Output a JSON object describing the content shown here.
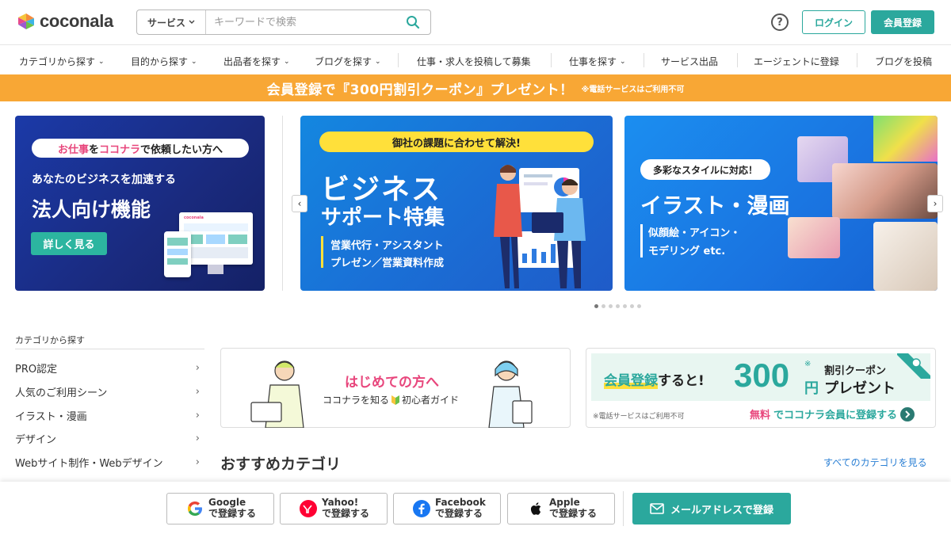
{
  "header": {
    "logo_text": "coconala",
    "search_category": "サービス",
    "search_placeholder": "キーワードで検索",
    "help_label": "?",
    "login_label": "ログイン",
    "register_label": "会員登録"
  },
  "nav": {
    "items": [
      {
        "label": "カテゴリから探す",
        "dropdown": true
      },
      {
        "label": "目的から探す",
        "dropdown": true
      },
      {
        "label": "出品者を探す",
        "dropdown": true
      },
      {
        "label": "ブログを探す",
        "dropdown": true
      },
      {
        "label": "仕事・求人を投稿して募集",
        "dropdown": false
      },
      {
        "label": "仕事を探す",
        "dropdown": true
      },
      {
        "label": "サービス出品",
        "dropdown": false
      },
      {
        "label": "エージェントに登録",
        "dropdown": false
      },
      {
        "label": "ブログを投稿",
        "dropdown": false
      }
    ]
  },
  "promo": {
    "main": "会員登録で『300円割引クーポン』プレゼント！",
    "note": "※電話サービスはご利用不可"
  },
  "banners": {
    "b1": {
      "tag_part1": "お仕事",
      "tag_part2": "を",
      "tag_part3": "ココナラ",
      "tag_part4": "で依頼したい方へ",
      "line1": "あなたのビジネスを加速する",
      "title": "法人向け機能",
      "button": "詳しく見る",
      "mini_logo": "coconala"
    },
    "b2": {
      "tag": "御社の課題に合わせて解決!",
      "title1": "ビジネス",
      "title2": "サポート特集",
      "sub1": "営業代行・アシスタント",
      "sub2": "プレゼン／営業資料作成"
    },
    "b3": {
      "tag": "多彩なスタイルに対応！",
      "title": "イラスト・漫画",
      "sub1": "似顔絵・アイコン・",
      "sub2": "モデリング etc."
    },
    "prev_arrow": "‹",
    "next_arrow": "›",
    "page_count": 7,
    "active_page": 1
  },
  "sidebar": {
    "title": "カテゴリから探す",
    "items": [
      {
        "label": "PRO認定"
      },
      {
        "label": "人気のご利用シーン"
      },
      {
        "label": "イラスト・漫画"
      },
      {
        "label": "デザイン"
      },
      {
        "label": "Webサイト制作・Webデザイン"
      }
    ],
    "chevron": "›"
  },
  "card_beginner": {
    "title": "はじめての方へ",
    "sub_part1": "ココナラを知る",
    "sub_part2": "初心者ガイド"
  },
  "card_signup": {
    "lead_part1": "会員登録",
    "lead_part2": "すると!",
    "amount": "300",
    "mark": "※",
    "unit": "円",
    "coupon_line1": "割引クーポン",
    "coupon_line2": "プレゼント",
    "note": "※電話サービスはご利用不可",
    "cta_part1": "無料",
    "cta_part2": "でココナラ会員に登録する"
  },
  "section": {
    "title": "おすすめカテゴリ",
    "link": "すべてのカテゴリを見る"
  },
  "signup_buttons": [
    {
      "provider": "Google",
      "action": "で登録する",
      "icon": "google-icon"
    },
    {
      "provider": "Yahoo!",
      "action": "で登録する",
      "icon": "yahoo-icon"
    },
    {
      "provider": "Facebook",
      "action": "で登録する",
      "icon": "facebook-icon"
    },
    {
      "provider": "Apple",
      "action": "で登録する",
      "icon": "apple-icon"
    }
  ],
  "mail_signup": "メールアドレスで登録",
  "colors": {
    "brand_green": "#2ba89d",
    "promo_orange": "#f8a735",
    "link_blue": "#2a7fd4"
  }
}
